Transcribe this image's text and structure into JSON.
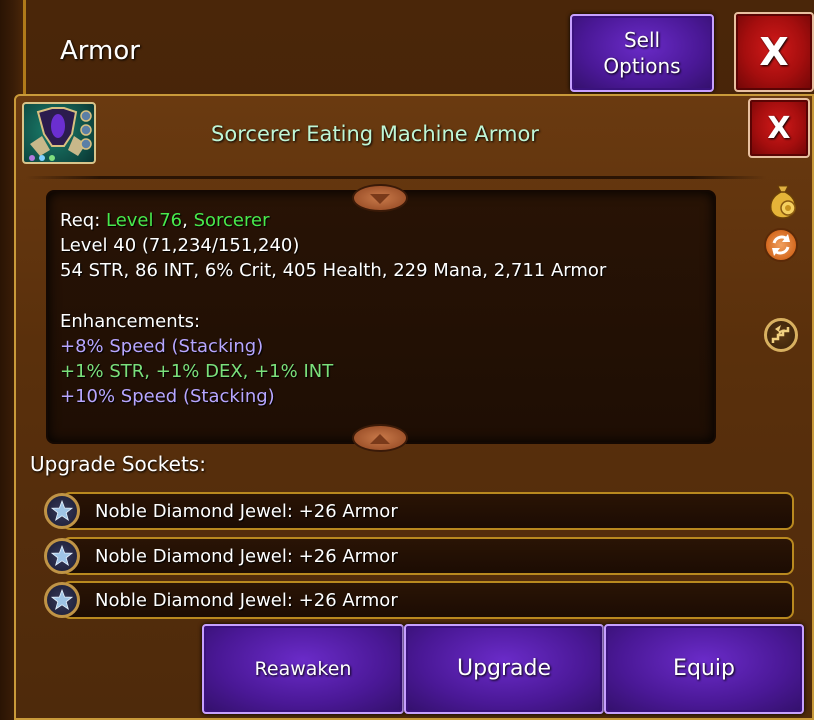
{
  "header": {
    "title": "Armor",
    "sell_options_label": "Sell Options",
    "close_label": "X"
  },
  "item": {
    "name": "Sorcerer Eating Machine Armor",
    "close_label": "X"
  },
  "stats": {
    "req_label": "Req: ",
    "req_level": "Level 76",
    "req_sep": ", ",
    "req_class": "Sorcerer",
    "level_line": "Level 40 (71,234/151,240)",
    "attributes_line": "54 STR, 86 INT, 6% Crit, 405 Health, 229 Mana, 2,711 Armor",
    "enhancements_label": "Enhancements:",
    "enhancements": [
      "+8% Speed (Stacking)",
      "+1% STR, +1% DEX, +1% INT",
      "+10% Speed (Stacking)"
    ]
  },
  "side_icons": [
    "money-bag-icon",
    "refresh-icon",
    "lightning-stairs-icon"
  ],
  "sockets": {
    "title": "Upgrade Sockets:",
    "items": [
      "Noble Diamond Jewel: +26 Armor",
      "Noble Diamond Jewel: +26 Armor",
      "Noble Diamond Jewel: +26 Armor"
    ]
  },
  "actions": {
    "reawaken": "Reawaken",
    "upgrade": "Upgrade",
    "equip": "Equip"
  },
  "colors": {
    "item_name": "#bff6d6",
    "green": "#48ea4c",
    "lilac": "#b7a6ff",
    "lime": "#7be07b",
    "purple_button": "#4a1896",
    "red_button": "#a50e0e"
  }
}
